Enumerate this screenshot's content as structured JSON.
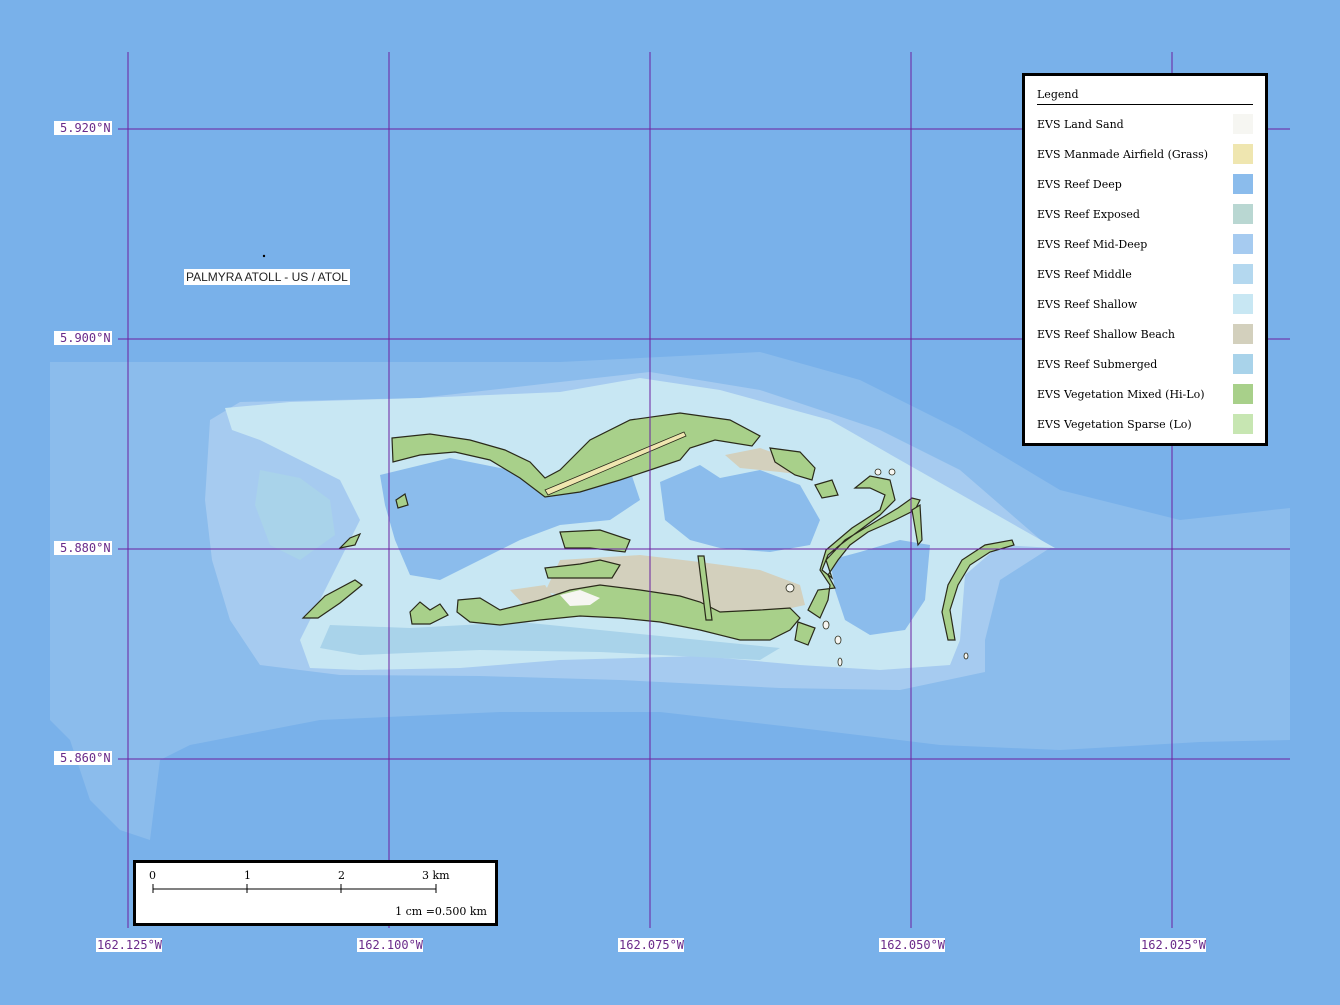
{
  "map": {
    "colors": {
      "ocean": "#79b1ea",
      "reef_deep": "#8bbcec",
      "reef_mid_deep": "#a6cbf0",
      "reef_middle": "#b4d8ef",
      "reef_shallow": "#c8e7f3",
      "reef_submerged": "#a9d3ea",
      "reef_shallow_beach": "#d3d0bd",
      "vegetation_mixed": "#a8d08a",
      "vegetation_sparse": "#c7e6b2",
      "land_sand": "#f6f6f2",
      "airfield": "#efe6b0",
      "grid": "#6a1fa0"
    },
    "latitude_labels": [
      "5.920°N",
      "5.900°N",
      "5.880°N",
      "5.860°N"
    ],
    "longitude_labels": [
      "162.125°W",
      "162.100°W",
      "162.075°W",
      "162.050°W",
      "162.025°W"
    ],
    "place_label": "PALMYRA ATOLL - US / ATOL"
  },
  "legend": {
    "title": "Legend",
    "items": [
      {
        "label": "EVS Land Sand",
        "color": "#f6f6f2"
      },
      {
        "label": "EVS Manmade Airfield (Grass)",
        "color": "#efe6b0"
      },
      {
        "label": "EVS Reef Deep",
        "color": "#8bbcec"
      },
      {
        "label": "EVS Reef Exposed",
        "color": "#b9d7d2"
      },
      {
        "label": "EVS Reef Mid-Deep",
        "color": "#a6cbf0"
      },
      {
        "label": "EVS Reef Middle",
        "color": "#b4d8ef"
      },
      {
        "label": "EVS Reef Shallow",
        "color": "#c8e7f3"
      },
      {
        "label": "EVS Reef Shallow Beach",
        "color": "#d3d0bd"
      },
      {
        "label": "EVS Reef Submerged",
        "color": "#a9d3ea"
      },
      {
        "label": "EVS Vegetation Mixed (Hi-Lo)",
        "color": "#a8d08a"
      },
      {
        "label": "EVS Vegetation Sparse (Lo)",
        "color": "#c7e6b2"
      }
    ]
  },
  "scale_bar": {
    "ticks": [
      "0",
      "1",
      "2",
      "3 km"
    ],
    "ratio_text": "1 cm =0.500 km"
  }
}
